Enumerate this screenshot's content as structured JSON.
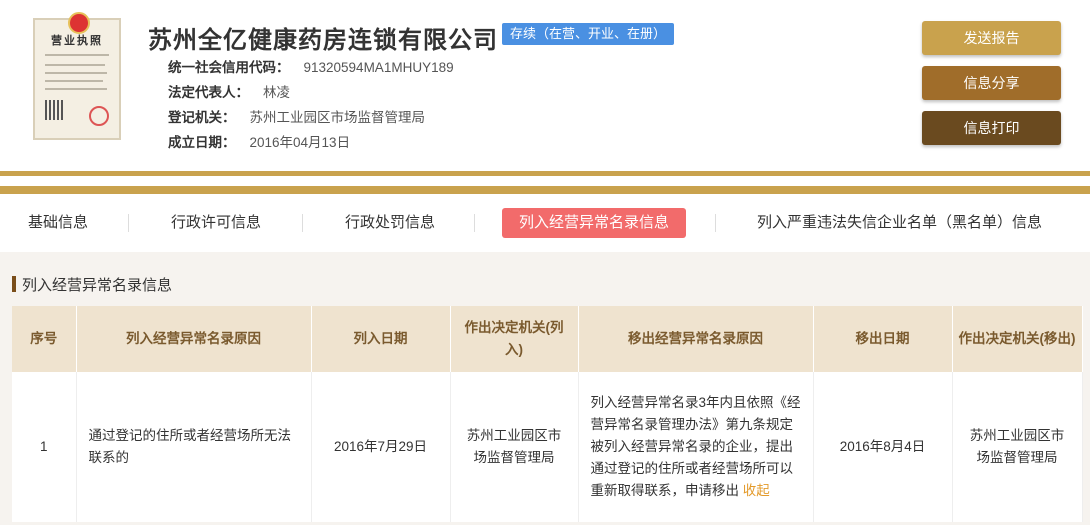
{
  "license": {
    "title": "营业执照"
  },
  "company": {
    "name": "苏州全亿健康药房连锁有限公司",
    "status": "存续（在营、开业、在册）",
    "fields": [
      {
        "key": "统一社会信用代码：",
        "value": "91320594MA1MHUY189"
      },
      {
        "key": "法定代表人：",
        "value": "林凌"
      },
      {
        "key": "登记机关：",
        "value": "苏州工业园区市场监督管理局"
      },
      {
        "key": "成立日期：",
        "value": "2016年04月13日"
      }
    ]
  },
  "actions": {
    "send": "发送报告",
    "share": "信息分享",
    "print": "信息打印"
  },
  "tabs": [
    "基础信息",
    "行政许可信息",
    "行政处罚信息",
    "列入经营异常名录信息",
    "列入严重违法失信企业名单（黑名单）信息"
  ],
  "section": {
    "title": "列入经营异常名录信息"
  },
  "table": {
    "headers": [
      "序号",
      "列入经营异常名录原因",
      "列入日期",
      "作出决定机关(列入)",
      "移出经营异常名录原因",
      "移出日期",
      "作出决定机关(移出)"
    ],
    "rows": [
      {
        "no": "1",
        "reason_in": "通过登记的住所或者经营场所无法联系的",
        "date_in": "2016年7月29日",
        "authority_in": "苏州工业园区市场监督管理局",
        "reason_out": "列入经营异常名录3年内且依照《经营异常名录管理办法》第九条规定被列入经营异常名录的企业，提出通过登记的住所或者经营场所可以重新取得联系，申请移出",
        "revoke": "收起",
        "date_out": "2016年8月4日",
        "authority_out": "苏州工业园区市场监督管理局"
      }
    ]
  },
  "colors": {
    "gold": "#c9a24d",
    "active_tab": "#f26b6b",
    "status": "#4a90e2"
  }
}
